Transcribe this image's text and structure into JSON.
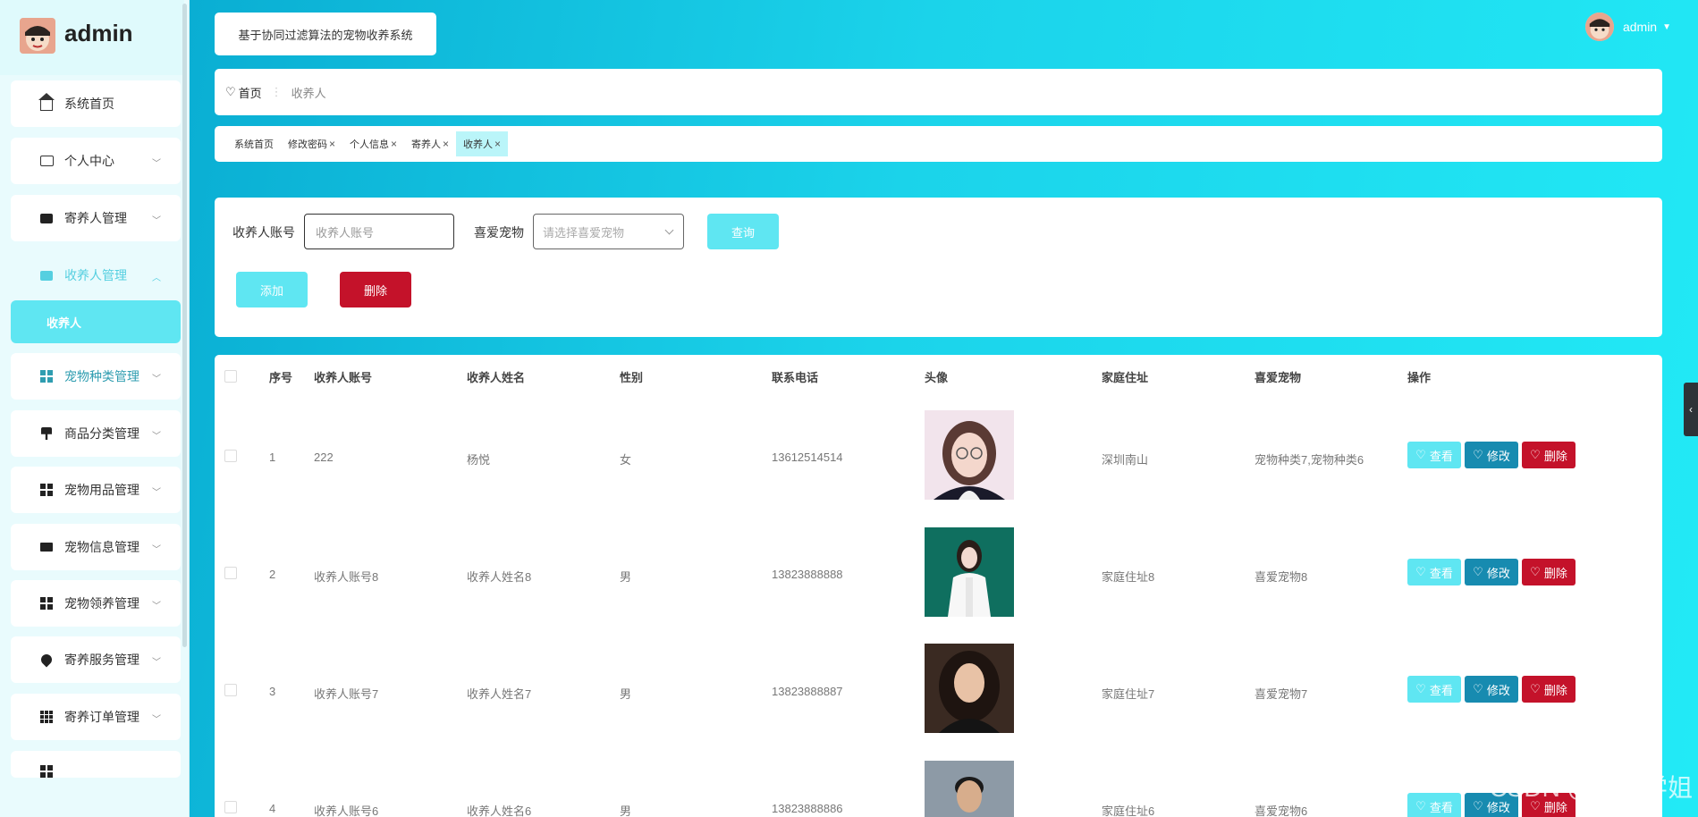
{
  "sidebar": {
    "title": "admin",
    "items": [
      {
        "label": "系统首页"
      },
      {
        "label": "个人中心"
      },
      {
        "label": "寄养人管理"
      },
      {
        "label": "收养人管理"
      },
      {
        "label": "宠物种类管理"
      },
      {
        "label": "商品分类管理"
      },
      {
        "label": "宠物用品管理"
      },
      {
        "label": "宠物信息管理"
      },
      {
        "label": "宠物领养管理"
      },
      {
        "label": "寄养服务管理"
      },
      {
        "label": "寄养订单管理"
      }
    ],
    "sub_item": "收养人"
  },
  "header": {
    "system_title": "基于协同过滤算法的宠物收养系统",
    "user": "admin"
  },
  "breadcrumb": {
    "home": "首页",
    "current": "收养人"
  },
  "tags": [
    {
      "label": "系统首页",
      "closable": false
    },
    {
      "label": "修改密码",
      "closable": true
    },
    {
      "label": "个人信息",
      "closable": true
    },
    {
      "label": "寄养人",
      "closable": true
    },
    {
      "label": "收养人",
      "closable": true
    }
  ],
  "search": {
    "account_label": "收养人账号",
    "account_placeholder": "收养人账号",
    "pet_label": "喜爱宠物",
    "pet_placeholder": "请选择喜爱宠物",
    "query_button": "查询",
    "add_button": "添加",
    "delete_button": "删除"
  },
  "table": {
    "columns": [
      "序号",
      "收养人账号",
      "收养人姓名",
      "性别",
      "联系电话",
      "头像",
      "家庭住址",
      "喜爱宠物",
      "操作"
    ],
    "rows": [
      {
        "index": "1",
        "account": "222",
        "name": "杨悦",
        "gender": "女",
        "phone": "13612514514",
        "address": "深圳南山",
        "pet": "宠物种类7,宠物种类6"
      },
      {
        "index": "2",
        "account": "收养人账号8",
        "name": "收养人姓名8",
        "gender": "男",
        "phone": "13823888888",
        "address": "家庭住址8",
        "pet": "喜爱宠物8"
      },
      {
        "index": "3",
        "account": "收养人账号7",
        "name": "收养人姓名7",
        "gender": "男",
        "phone": "13823888887",
        "address": "家庭住址7",
        "pet": "喜爱宠物7"
      },
      {
        "index": "4",
        "account": "收养人账号6",
        "name": "收养人姓名6",
        "gender": "男",
        "phone": "13823888886",
        "address": "家庭住址6",
        "pet": "喜爱宠物6"
      }
    ],
    "actions": {
      "view": "查看",
      "edit": "修改",
      "delete": "删除"
    }
  },
  "watermark": "CSDN @茹茹学姐"
}
